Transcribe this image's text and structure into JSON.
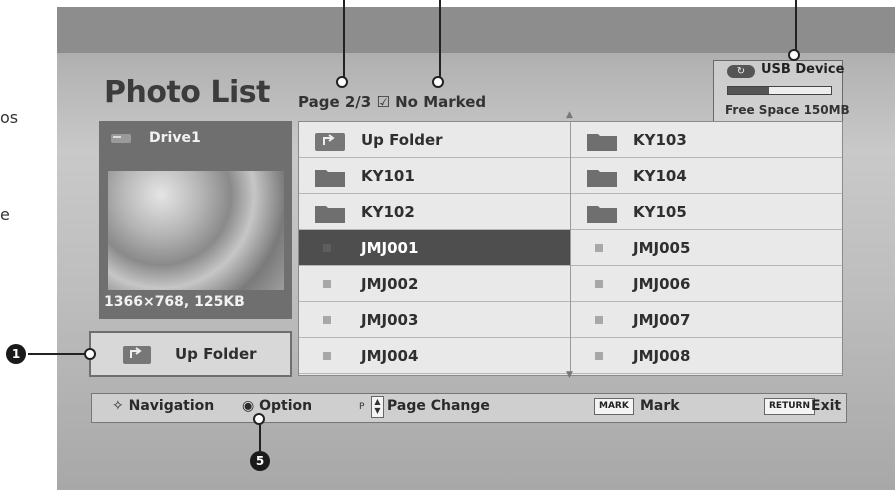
{
  "edge_text": {
    "top": "os",
    "mid": "e"
  },
  "title": "Photo List",
  "page_info": {
    "page": "Page 2/3",
    "marked": "No Marked"
  },
  "usb": {
    "label": "USB Device",
    "free_space": "Free Space 150MB",
    "used_fraction": 0.4
  },
  "preview": {
    "drive": "Drive1",
    "info": "1366×768, 125KB",
    "up_folder": "Up Folder"
  },
  "list": {
    "left": [
      {
        "label": "Up Folder",
        "icon": "up-folder-icon"
      },
      {
        "label": "KY101",
        "icon": "folder-icon"
      },
      {
        "label": "KY102",
        "icon": "folder-icon"
      },
      {
        "label": "JMJ001",
        "icon": "photo-file-icon",
        "selected": true
      },
      {
        "label": "JMJ002",
        "icon": "photo-file-icon"
      },
      {
        "label": "JMJ003",
        "icon": "photo-file-icon"
      },
      {
        "label": "JMJ004",
        "icon": "photo-file-icon"
      }
    ],
    "right": [
      {
        "label": "KY103",
        "icon": "folder-icon"
      },
      {
        "label": "KY104",
        "icon": "folder-icon"
      },
      {
        "label": "KY105",
        "icon": "folder-icon"
      },
      {
        "label": "JMJ005",
        "icon": "photo-file-icon"
      },
      {
        "label": "JMJ006",
        "icon": "photo-file-icon"
      },
      {
        "label": "JMJ007",
        "icon": "photo-file-icon"
      },
      {
        "label": "JMJ008",
        "icon": "photo-file-icon"
      }
    ]
  },
  "bottom_bar": {
    "navigation": "Navigation",
    "option": "Option",
    "p_key": "P",
    "page_change": "Page Change",
    "mark_key": "MARK",
    "mark": "Mark",
    "return_key": "RETURN",
    "exit": "Exit"
  },
  "callouts": {
    "one": "1",
    "five": "5"
  }
}
